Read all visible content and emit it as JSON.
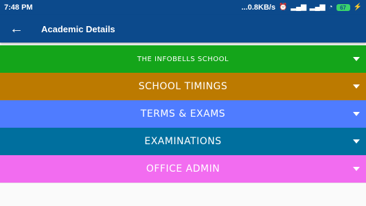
{
  "status_bar": {
    "time": "7:48 PM",
    "network": "...0.8KB/s",
    "battery": "67"
  },
  "app_bar": {
    "title": "Academic Details"
  },
  "sections": [
    {
      "label": "THE INFOBELLS SCHOOL",
      "color": "#14a51a"
    },
    {
      "label": "SCHOOL TIMINGS",
      "color": "#bc7a00"
    },
    {
      "label": "TERMS & EXAMS",
      "color": "#4f7cff"
    },
    {
      "label": "EXAMINATIONS",
      "color": "#006f9e"
    },
    {
      "label": "OFFICE ADMIN",
      "color": "#f26cf0"
    }
  ],
  "icons": {
    "back": "arrow-left",
    "expand": "caret-down"
  }
}
